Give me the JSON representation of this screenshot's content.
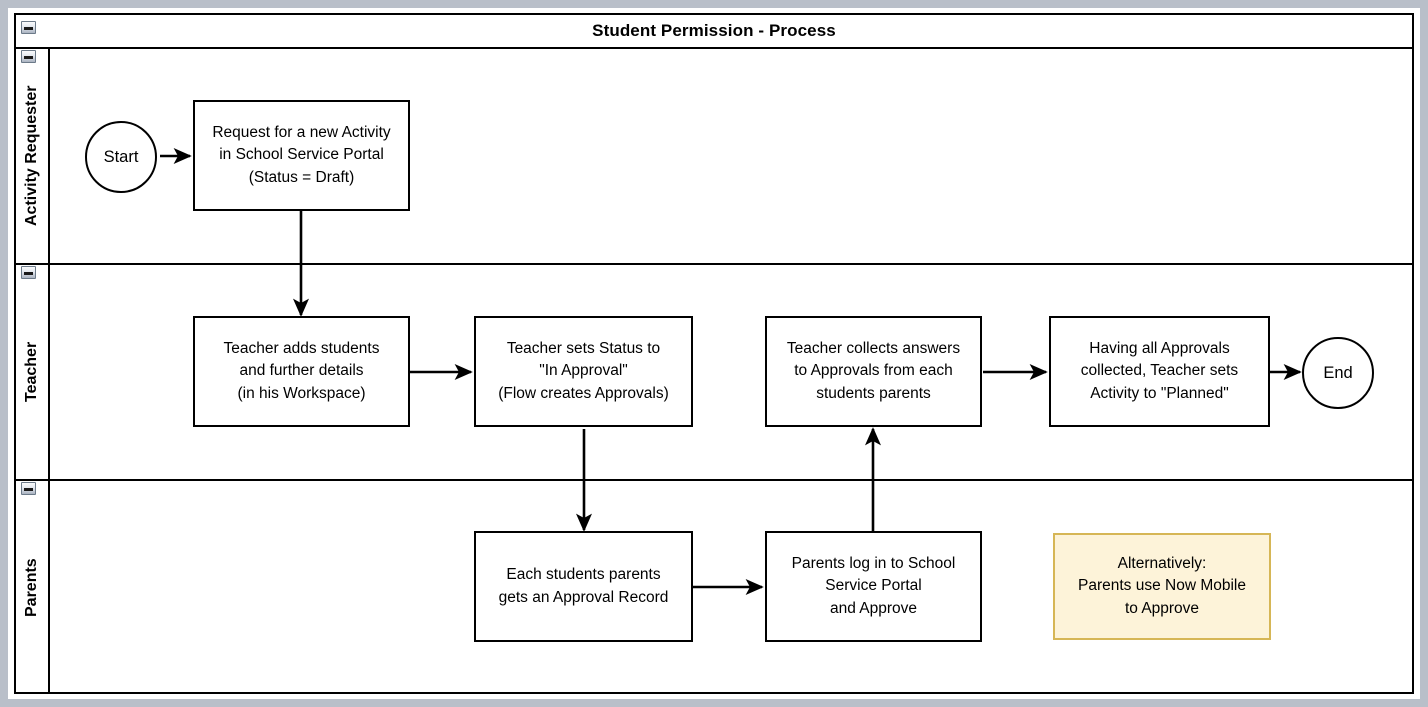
{
  "diagram": {
    "title": "Student Permission - Process",
    "type": "swimlane-flowchart",
    "colors": {
      "stroke": "#000000",
      "shape_fill": "#ffffff",
      "note_fill": "#fdf3d9",
      "note_border": "#d6b656",
      "viewer_frame": "#b9bfc9"
    }
  },
  "lanes": [
    {
      "id": "activity-requester",
      "label": "Activity Requester",
      "collapse_icon": "minus-icon"
    },
    {
      "id": "teacher",
      "label": "Teacher",
      "collapse_icon": "minus-icon"
    },
    {
      "id": "parents",
      "label": "Parents",
      "collapse_icon": "minus-icon"
    }
  ],
  "pool": {
    "collapse_icon": "minus-icon"
  },
  "nodes": {
    "start": {
      "label": "Start",
      "shape": "circle",
      "lane": "activity-requester"
    },
    "request_activity": {
      "label": "Request for a new Activity\nin School Service Portal\n(Status = Draft)",
      "shape": "rectangle",
      "lane": "activity-requester"
    },
    "teacher_adds_students": {
      "label": "Teacher adds students\nand further details\n(in his Workspace)",
      "shape": "rectangle",
      "lane": "teacher"
    },
    "teacher_sets_status": {
      "label": "Teacher sets Status to\n\"In Approval\"\n(Flow creates Approvals)",
      "shape": "rectangle",
      "lane": "teacher"
    },
    "teacher_collects_answers": {
      "label": "Teacher collects answers\nto Approvals from each\nstudents parents",
      "shape": "rectangle",
      "lane": "teacher"
    },
    "teacher_sets_planned": {
      "label": "Having all Approvals\ncollected, Teacher sets\nActivity to \"Planned\"",
      "shape": "rectangle",
      "lane": "teacher"
    },
    "end": {
      "label": "End",
      "shape": "circle",
      "lane": "teacher"
    },
    "approval_record": {
      "label": "Each students parents\ngets an Approval Record",
      "shape": "rectangle",
      "lane": "parents"
    },
    "parents_log_in": {
      "label": "Parents log in to School\nService Portal\nand Approve",
      "shape": "rectangle",
      "lane": "parents"
    },
    "alternative_note": {
      "label": "Alternatively:\nParents use Now Mobile\nto Approve",
      "shape": "note",
      "lane": "parents"
    }
  },
  "edges": [
    {
      "from": "start",
      "to": "request_activity",
      "direction": "right"
    },
    {
      "from": "request_activity",
      "to": "teacher_adds_students",
      "direction": "down"
    },
    {
      "from": "teacher_adds_students",
      "to": "teacher_sets_status",
      "direction": "right"
    },
    {
      "from": "teacher_sets_status",
      "to": "approval_record",
      "direction": "down"
    },
    {
      "from": "approval_record",
      "to": "parents_log_in",
      "direction": "right"
    },
    {
      "from": "parents_log_in",
      "to": "teacher_collects_answers",
      "direction": "up"
    },
    {
      "from": "teacher_collects_answers",
      "to": "teacher_sets_planned",
      "direction": "right"
    },
    {
      "from": "teacher_sets_planned",
      "to": "end",
      "direction": "right"
    }
  ]
}
